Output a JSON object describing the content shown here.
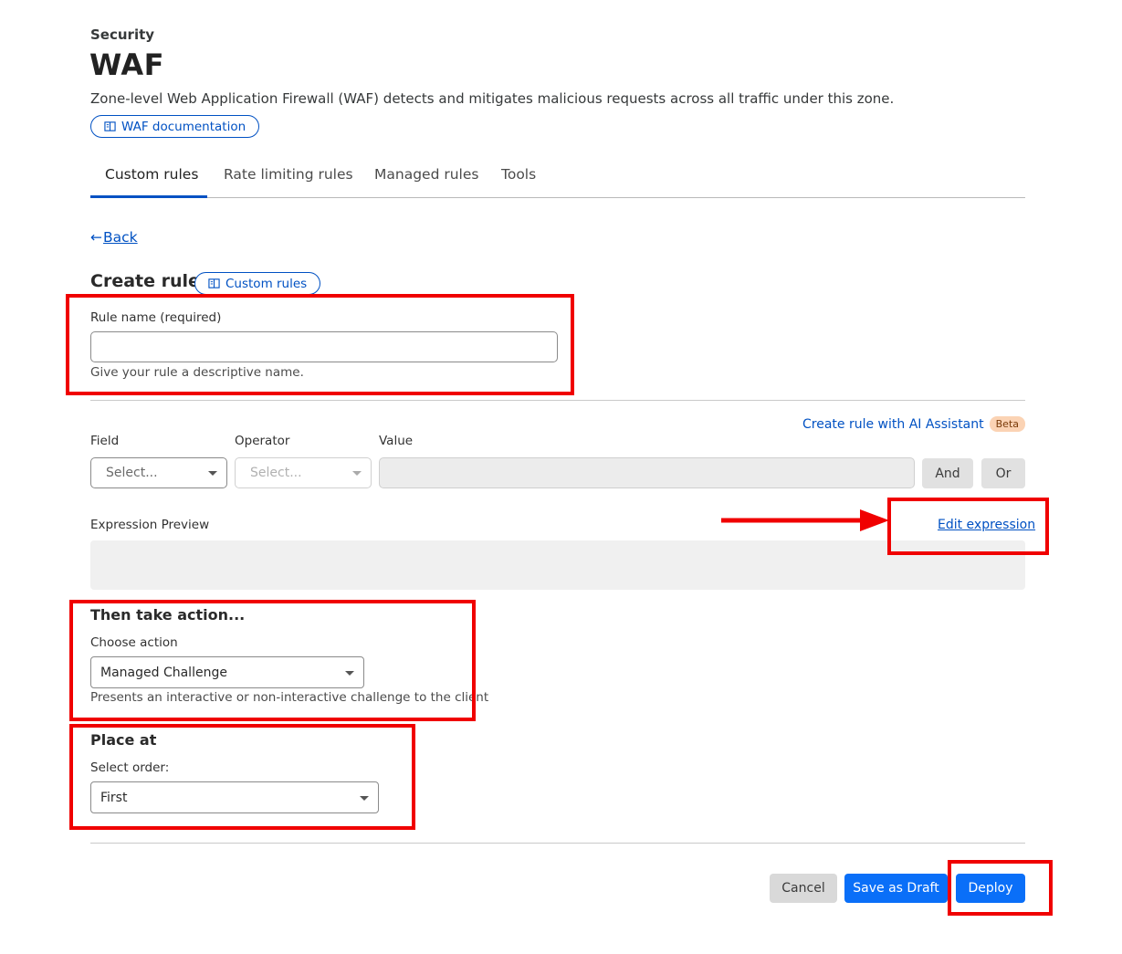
{
  "header": {
    "section": "Security",
    "title": "WAF",
    "description": "Zone-level Web Application Firewall (WAF) detects and mitigates malicious requests across all traffic under this zone.",
    "doc_link": "WAF documentation"
  },
  "tabs": [
    {
      "label": "Custom rules",
      "active": true
    },
    {
      "label": "Rate limiting rules",
      "active": false
    },
    {
      "label": "Managed rules",
      "active": false
    },
    {
      "label": "Tools",
      "active": false
    }
  ],
  "back_label": "Back",
  "form": {
    "title": "Create rule",
    "custom_rules_link": "Custom rules",
    "rule_name_label": "Rule name (required)",
    "rule_name_value": "",
    "rule_name_help": "Give your rule a descriptive name.",
    "ai_assistant_link": "Create rule with AI Assistant",
    "beta_badge": "Beta",
    "field_label": "Field",
    "field_placeholder": "Select...",
    "operator_label": "Operator",
    "operator_placeholder": "Select...",
    "value_label": "Value",
    "value_value": "",
    "and_label": "And",
    "or_label": "Or",
    "expression_preview_label": "Expression Preview",
    "edit_expression_link": "Edit expression",
    "action_heading": "Then take action...",
    "choose_action_label": "Choose action",
    "action_selected": "Managed Challenge",
    "action_help": "Presents an interactive or non-interactive challenge to the client",
    "place_heading": "Place at",
    "select_order_label": "Select order:",
    "order_selected": "First"
  },
  "footer": {
    "cancel": "Cancel",
    "save_draft": "Save as Draft",
    "deploy": "Deploy"
  },
  "colors": {
    "accent": "#0051c3",
    "primary_button": "#0a6ff8",
    "annotation": "#f00000"
  }
}
